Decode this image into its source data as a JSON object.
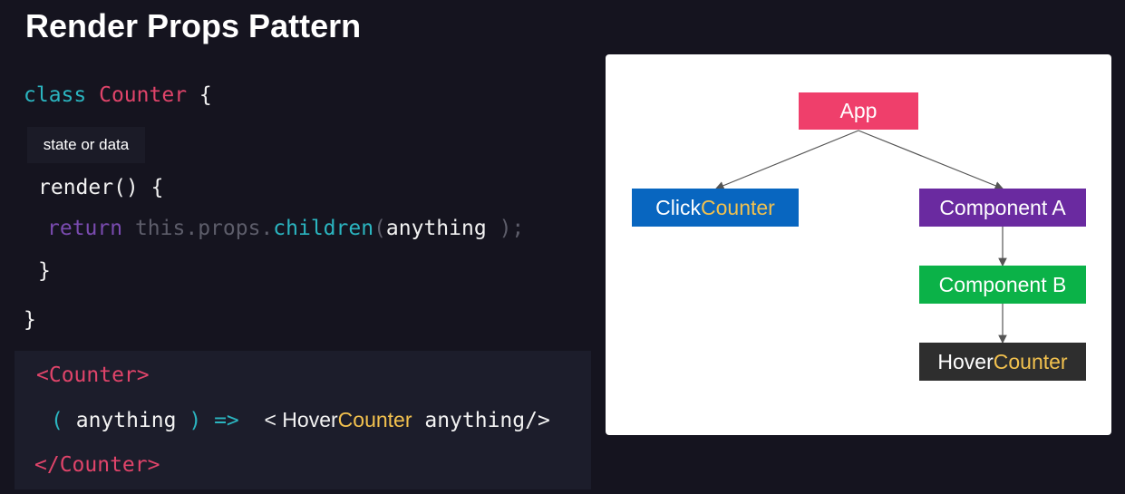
{
  "title": "Render Props Pattern",
  "code": {
    "class_kw": "class",
    "class_name": "Counter",
    "open_brace": "{",
    "note": "state or data",
    "render_line": "render() {",
    "return_kw": "return",
    "this_props": "this.props.",
    "children": "children",
    "paren_open": "(",
    "arg": "anything",
    "paren_close": ");",
    "close_inner": "}",
    "close_outer": "}"
  },
  "usage": {
    "open_tag": "<Counter>",
    "lparen": "(",
    "arg": "anything",
    "rparen": ")",
    "arrow": "=>",
    "jsx_open": "< Hover",
    "jsx_counter": "Counter",
    "jsx_prop": " anything",
    "jsx_close": "/>",
    "close_tag": "</Counter>"
  },
  "diagram": {
    "nodes": [
      {
        "id": "app",
        "label": "App",
        "color": "#ef3f6b"
      },
      {
        "id": "click",
        "label_a": "Click",
        "label_b": "Counter",
        "color": "#0866c0"
      },
      {
        "id": "compA",
        "label": "Component A",
        "color": "#6a2aa0"
      },
      {
        "id": "compB",
        "label": "Component B",
        "color": "#0bb248"
      },
      {
        "id": "hover",
        "label_a": "Hover",
        "label_b": "Counter",
        "color": "#2e2e2e"
      }
    ],
    "edges": [
      [
        "app",
        "click"
      ],
      [
        "app",
        "compA"
      ],
      [
        "compA",
        "compB"
      ],
      [
        "compB",
        "hover"
      ]
    ],
    "highlight_color": "#f2c14e"
  }
}
